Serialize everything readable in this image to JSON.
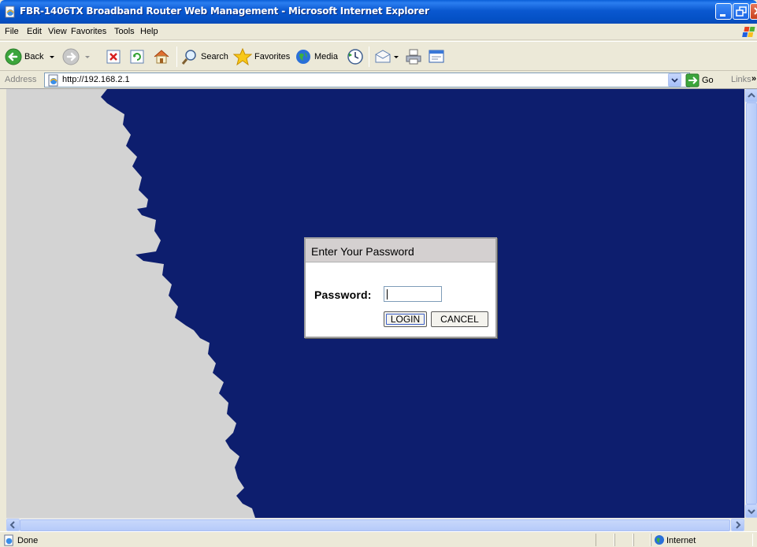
{
  "window": {
    "title": "FBR-1406TX Broadband Router Web Management - Microsoft Internet Explorer"
  },
  "menu": {
    "items": [
      "File",
      "Edit",
      "View",
      "Favorites",
      "Tools",
      "Help"
    ]
  },
  "toolbar": {
    "back_label": "Back",
    "search_label": "Search",
    "favorites_label": "Favorites",
    "media_label": "Media"
  },
  "address": {
    "label": "Address",
    "url": "http://192.168.2.1",
    "go_label": "Go",
    "links_label": "Links"
  },
  "dialog": {
    "title": "Enter Your Password",
    "password_label": "Password:",
    "password_value": "",
    "login_label": "LOGIN",
    "cancel_label": "CANCEL"
  },
  "status": {
    "text": "Done",
    "zone": "Internet"
  },
  "colors": {
    "page_background": "#0d1e6e",
    "torn_edge": "#d3d3d3",
    "title_bar": "#0a58d0"
  }
}
